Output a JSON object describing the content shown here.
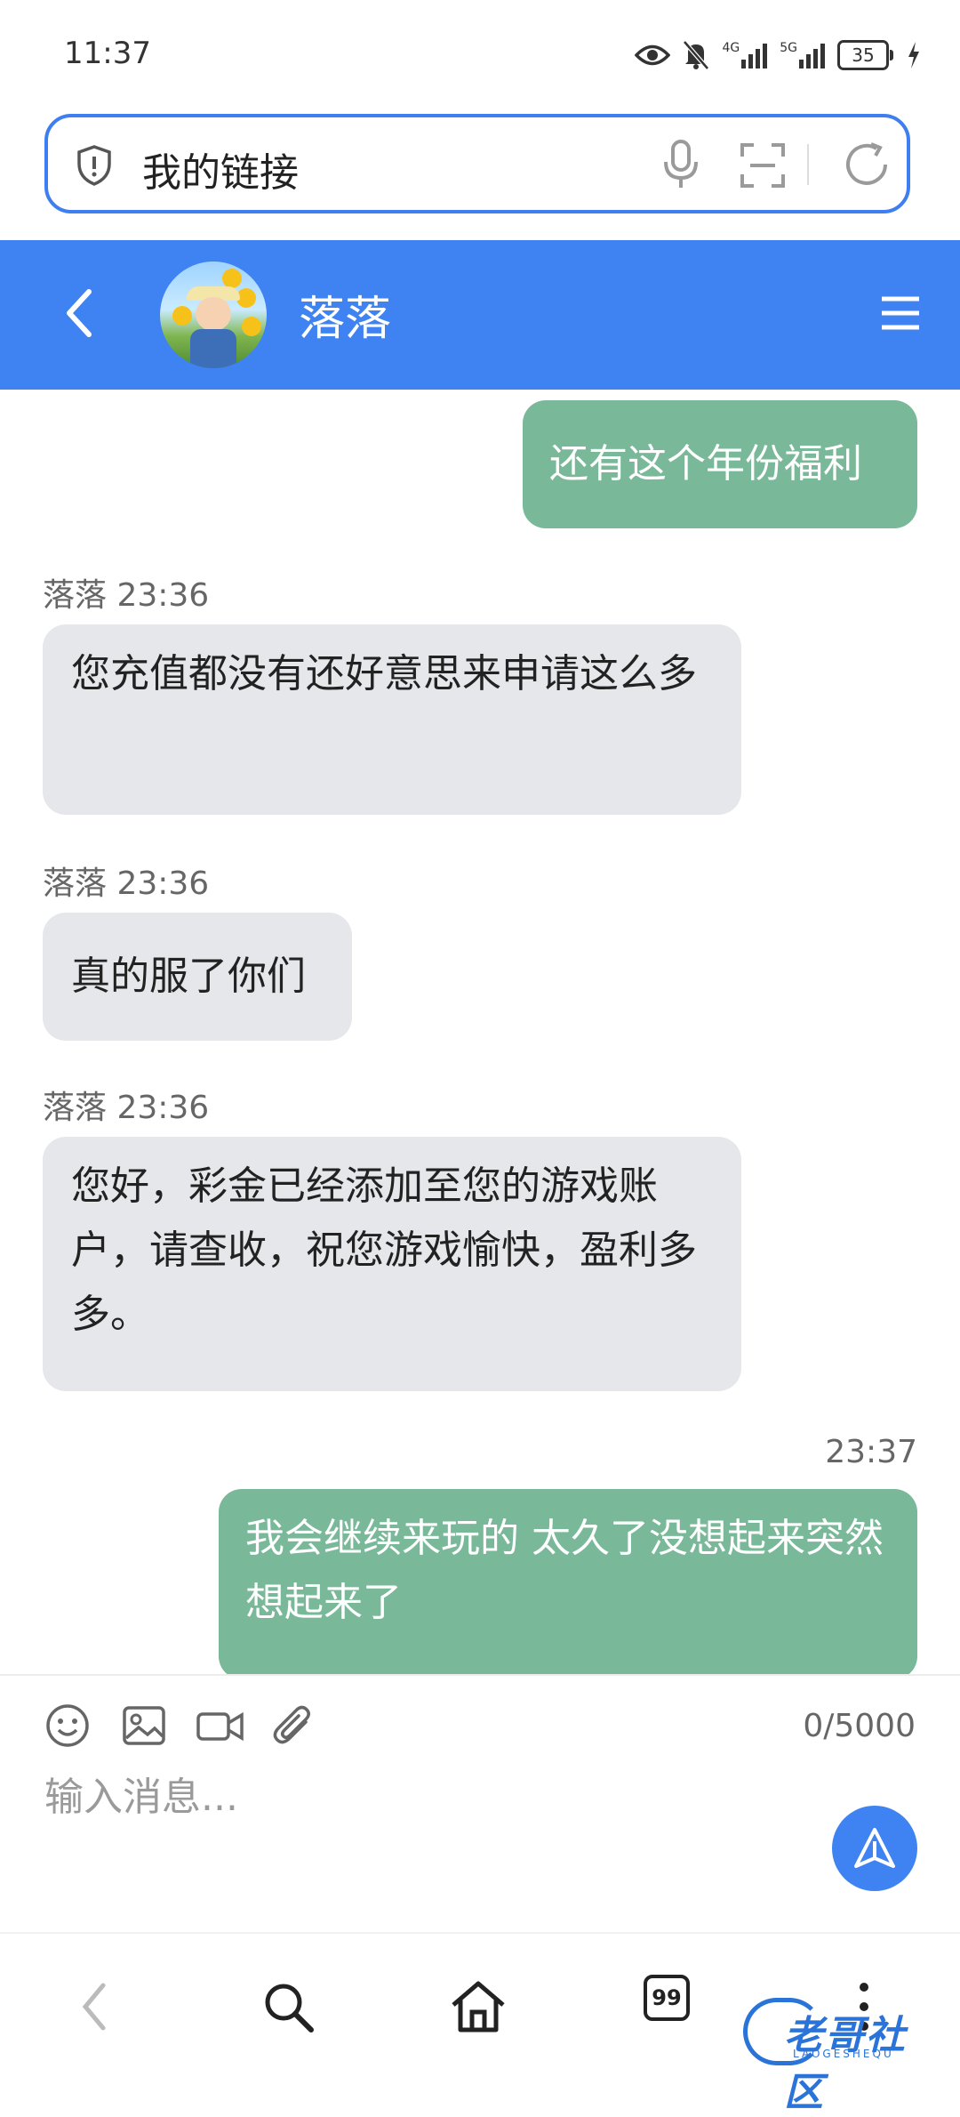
{
  "status_bar": {
    "time": "11:37",
    "network_1": "4G",
    "network_2": "5G",
    "battery": "35",
    "icons": [
      "eye-icon",
      "mute-bell-icon",
      "signal-icon",
      "signal-icon",
      "battery-icon",
      "charging-icon"
    ]
  },
  "url_bar": {
    "text": "我的链接",
    "icons": [
      "shield-icon",
      "microphone-icon",
      "scan-icon",
      "reload-icon"
    ]
  },
  "chat_header": {
    "contact_name": "落落",
    "icons": [
      "back-arrow-icon",
      "avatar",
      "menu-icon"
    ],
    "accent_color": "#3f83f2"
  },
  "messages": [
    {
      "direction": "out",
      "text": "还有这个年份福利"
    },
    {
      "direction": "in",
      "sender": "落落",
      "time": "23:36",
      "text": "您充值都没有还好意思来申请这么多"
    },
    {
      "direction": "in",
      "sender": "落落",
      "time": "23:36",
      "text": "真的服了你们"
    },
    {
      "direction": "in",
      "sender": "落落",
      "time": "23:36",
      "text": "您好，彩金已经添加至您的游戏账户，请查收，祝您游戏愉快，盈利多多。"
    },
    {
      "direction": "out",
      "time": "23:37",
      "text": "我会继续来玩的 太久了没想起来突然想起来了"
    }
  ],
  "bubble_colors": {
    "outgoing": "#79b898",
    "incoming": "#e6e7eb"
  },
  "composer": {
    "placeholder": "输入消息...",
    "char_counter": "0/5000",
    "tools": [
      "emoji-icon",
      "image-icon",
      "video-icon",
      "attachment-icon"
    ],
    "send_icon": "send-icon"
  },
  "browser_nav": {
    "tabs_count": "99",
    "icons": [
      "back-icon",
      "search-icon",
      "home-icon",
      "tabs-icon",
      "more-icon"
    ],
    "watermark": {
      "text": "老哥社区",
      "sub": "LAOGESHEQU"
    }
  }
}
